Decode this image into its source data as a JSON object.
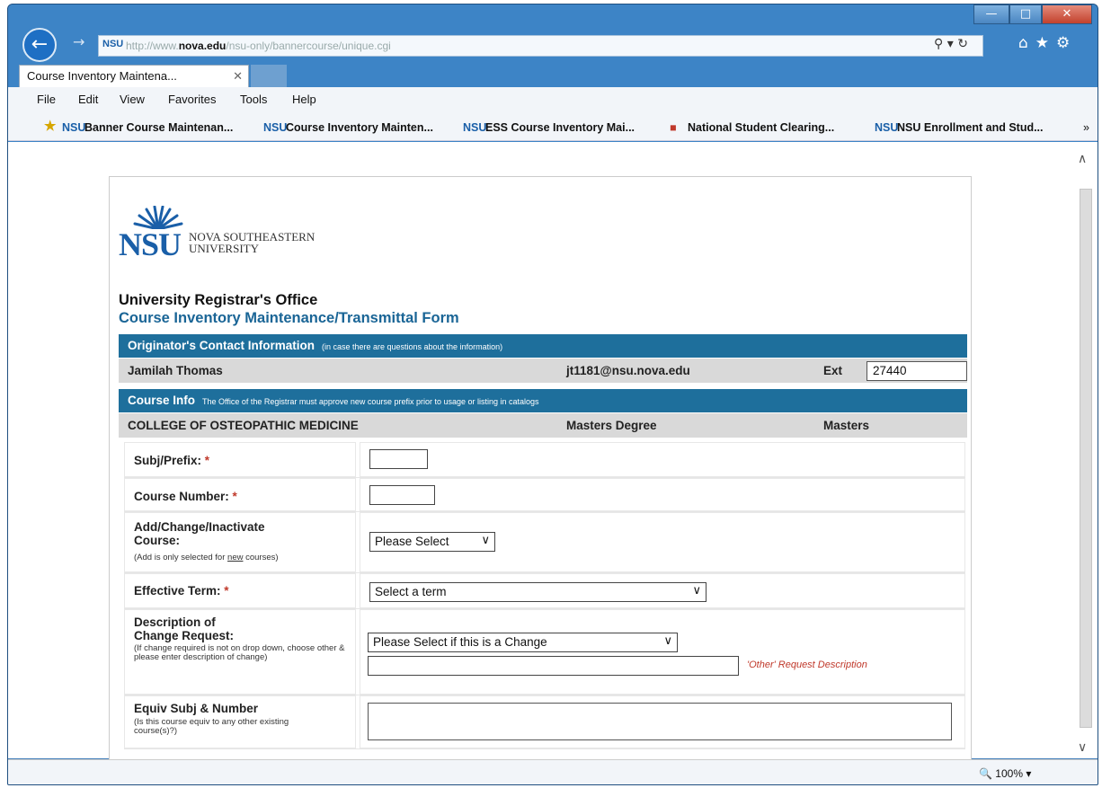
{
  "browser": {
    "url_prefix": "http://www.",
    "url_domain": "nova.edu",
    "url_path": "/nsu-only/bannercourse/unique.cgi",
    "tab_title": "Course Inventory Maintena...",
    "menu": [
      "File",
      "Edit",
      "View",
      "Favorites",
      "Tools",
      "Help"
    ],
    "favorites": [
      "Banner Course Maintenan...",
      "Course Inventory Mainten...",
      "ESS  Course Inventory Mai...",
      "National Student Clearing...",
      "NSU Enrollment and Stud..."
    ],
    "zoom": "100%"
  },
  "logo": {
    "abbr": "NSU",
    "line1": "NOVA SOUTHEASTERN",
    "line2": "UNIVERSITY"
  },
  "header": {
    "office": "University Registrar's Office",
    "form_title": "Course Inventory Maintenance/Transmittal Form"
  },
  "originator": {
    "section_title": "Originator's Contact Information",
    "section_note": "(in case there are questions about the information)",
    "name": "Jamilah Thomas",
    "email": "jt1181@nsu.nova.edu",
    "ext_label": "Ext",
    "ext_value": "27440"
  },
  "course_info": {
    "section_title": "Course Info",
    "section_note": "The Office of the Registrar must approve new course prefix prior to usage or listing in catalogs",
    "college": "COLLEGE OF OSTEOPATHIC MEDICINE",
    "degree": "Masters Degree",
    "level": "Masters"
  },
  "fields": {
    "subj_label": "Subj/Prefix:",
    "course_number_label": "Course Number:",
    "required_mark": "*",
    "action_label_1": "Add/Change/Inactivate",
    "action_label_2": "Course:",
    "action_note_pre": "(Add is only selected for ",
    "action_note_em": "new",
    "action_note_post": " courses)",
    "action_select": "Please Select",
    "term_label": "Effective Term:",
    "term_select": "Select a term",
    "desc_label_1": "Description of",
    "desc_label_2": "Change Request:",
    "desc_note": "(If change required is not on drop down, choose other & please enter description of change)",
    "desc_select": "Please Select if this is a Change",
    "other_label": "'Other' Request Description",
    "equiv_label": "Equiv Subj & Number",
    "equiv_note": "(Is this course equiv to any other existing course(s)?)"
  }
}
